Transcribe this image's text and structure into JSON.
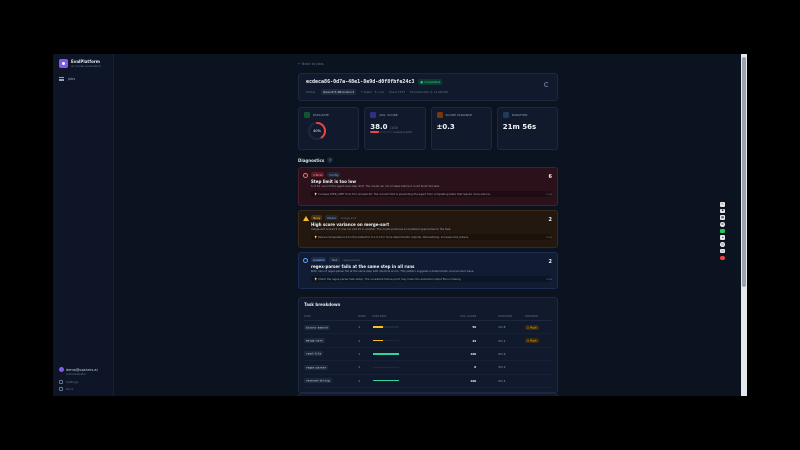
{
  "brand": {
    "name": "EvalPlatform",
    "sub": "AI model evaluation"
  },
  "nav": {
    "item_label": "Jobs"
  },
  "user": {
    "email": "demo@opshmx.ai",
    "role": "Administrator",
    "links": [
      "Settings",
      "Docs"
    ]
  },
  "back_label": "Back to jobs",
  "run": {
    "id": "ecdeca86-0d7a-48e1-8e9d-d0f8fbfe24c3",
    "status": "completed",
    "meta": [
      "Model:",
      "Qwen3.5-9B-Instruct",
      "7 tasks · 5 runs",
      "Seed 1337",
      "Finished Mar 4, 11:06 PM"
    ]
  },
  "stats": [
    {
      "label": "Pass rate",
      "value": "40%",
      "fraction": 0.4,
      "color": "#ef4444"
    },
    {
      "label": "Avg. score",
      "value": "38.0",
      "unit": "/100",
      "note": "Lowest quartile",
      "fraction": 0.38
    },
    {
      "label": "Score variance",
      "value": "±0.3",
      "note": ""
    },
    {
      "label": "Duration",
      "value": "21m 56s",
      "note": ""
    }
  ],
  "diagnostics": {
    "title": "Diagnostics",
    "count": "3",
    "items": [
      {
        "severity": "critical",
        "tag2": "Config",
        "tag3": "",
        "title": "Step limit is too low",
        "desc": "5 of 10 runs hit the agent-loop step limit. The model ran out of steps before it could finish the task.",
        "hint": "Increase STEP_LIMIT from 8 to at least 20. The current limit is preventing the agent from completing tasks that require more actions.",
        "count": "6",
        "count_label": "runs"
      },
      {
        "severity": "likely",
        "tag2": "Model",
        "tag3": "merge-sort",
        "title": "High score variance on merge-sort",
        "desc": "merge-sort scored 0 in one run and 25 in another. The model produces inconsistent approaches to the task.",
        "hint": "Reduce temperature from the default to 0.1–0.3 for more deterministic outputs. Alternatively, increase max_tokens.",
        "count": "2",
        "count_label": "runs"
      },
      {
        "severity": "possible",
        "tag2": "Task",
        "tag3": "regex-parser",
        "title": "regex-parser fails at the same step in all runs",
        "desc": "Both runs of regex-parser fail at the same step with identical errors. This pattern suggests a deterministic environment issue.",
        "hint": "Check the regex-parser task setup. The consistent failure point may mean the expected output file is missing.",
        "count": "2",
        "count_label": "runs"
      }
    ]
  },
  "tasks": {
    "title": "Task breakdown",
    "headers": [
      "Task",
      "Runs",
      "Pass rate",
      "Avg. score",
      "Duration",
      "Variance"
    ],
    "rows": [
      {
        "name": "binary-search",
        "runs": "1",
        "pass": 0.4,
        "color": "#fbbf24",
        "score": "50",
        "duration": "1m 8",
        "variance": "⚠ High"
      },
      {
        "name": "merge-sort",
        "runs": "1",
        "pass": 0.4,
        "color": "#fbbf24",
        "score": "25",
        "duration": "2m 1",
        "variance": "⚠ High"
      },
      {
        "name": "read-file",
        "runs": "1",
        "pass": 1.0,
        "color": "#34d399",
        "score": "100",
        "duration": "0m 6",
        "variance": ""
      },
      {
        "name": "regex-parser",
        "runs": "1",
        "pass": 0.0,
        "color": "#64748b",
        "score": "0",
        "duration": "3m 2",
        "variance": ""
      },
      {
        "name": "reverse-string",
        "runs": "1",
        "pass": 1.0,
        "color": "#34d399",
        "score": "100",
        "duration": "0m 5",
        "variance": ""
      }
    ]
  },
  "toolbar_icons": [
    "cursor-icon",
    "camera-icon",
    "grid-icon",
    "settings-icon",
    "mic-icon",
    "volume-icon",
    "clock-icon",
    "folder-icon",
    "stop-icon"
  ]
}
